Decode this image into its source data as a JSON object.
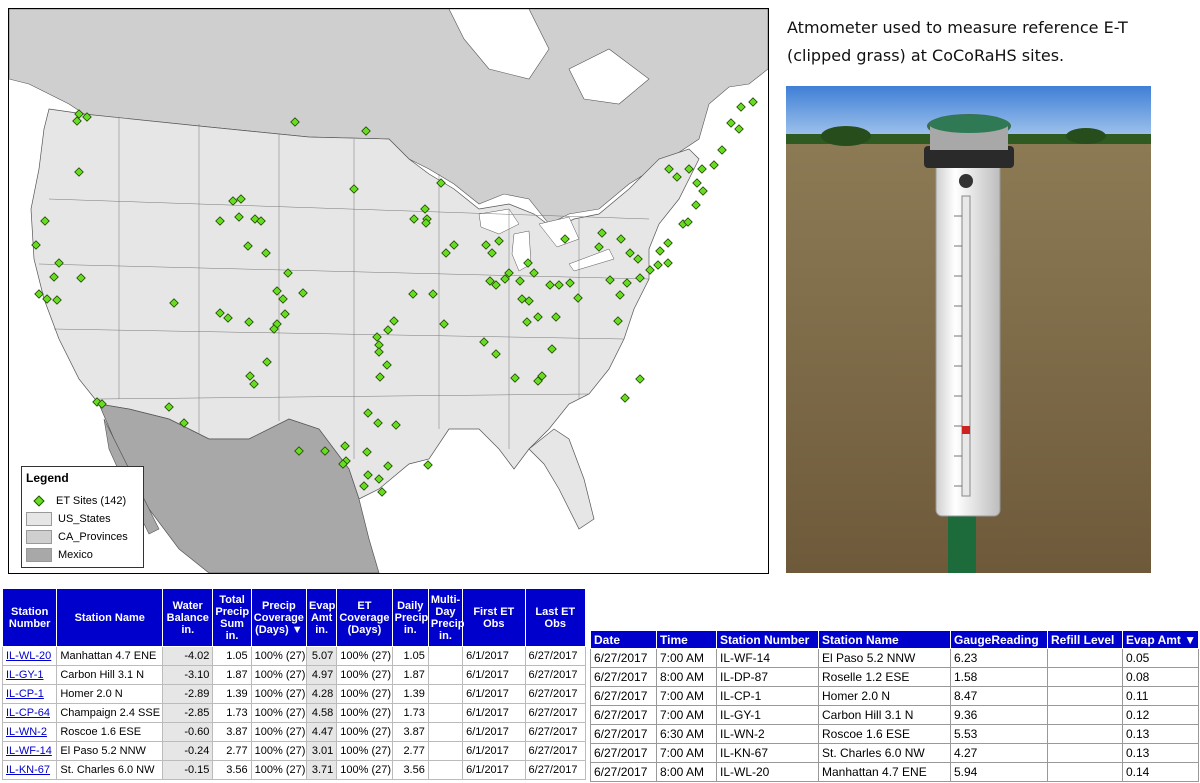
{
  "map": {
    "legend": {
      "title": "Legend",
      "items": [
        {
          "label": "ET Sites (142)",
          "kind": "marker",
          "color": "#66dd22"
        },
        {
          "label": "US_States",
          "kind": "swatch",
          "color": "#e6e6e6"
        },
        {
          "label": "CA_Provinces",
          "kind": "swatch",
          "color": "#cfcfcf"
        },
        {
          "label": "Mexico",
          "kind": "swatch",
          "color": "#a8a8a8"
        }
      ]
    },
    "colors": {
      "ocean": "#ffffff",
      "us_states": "#e6e6e6",
      "canada": "#cfcfcf",
      "mexico": "#a8a8a8",
      "marker": "#66dd22"
    }
  },
  "caption": "Atmometer used to measure reference E-T (clipped grass) at CoCoRaHS sites.",
  "left_table": {
    "headers": [
      "Station Number",
      "Station Name",
      "Water Balance in.",
      "Total Precip Sum in.",
      "Precip Coverage (Days) ▼",
      "Evap Amt in.",
      "ET Coverage (Days)",
      "Daily Precip in.",
      "Multi-Day Precip in.",
      "First ET Obs",
      "Last ET Obs"
    ],
    "rows": [
      [
        "IL-WL-20",
        "Manhattan 4.7 ENE",
        "-4.02",
        "1.05",
        "100% (27)",
        "5.07",
        "100% (27)",
        "1.05",
        "",
        "6/1/2017",
        "6/27/2017"
      ],
      [
        "IL-GY-1",
        "Carbon Hill 3.1 N",
        "-3.10",
        "1.87",
        "100% (27)",
        "4.97",
        "100% (27)",
        "1.87",
        "",
        "6/1/2017",
        "6/27/2017"
      ],
      [
        "IL-CP-1",
        "Homer 2.0 N",
        "-2.89",
        "1.39",
        "100% (27)",
        "4.28",
        "100% (27)",
        "1.39",
        "",
        "6/1/2017",
        "6/27/2017"
      ],
      [
        "IL-CP-64",
        "Champaign 2.4 SSE",
        "-2.85",
        "1.73",
        "100% (27)",
        "4.58",
        "100% (27)",
        "1.73",
        "",
        "6/1/2017",
        "6/27/2017"
      ],
      [
        "IL-WN-2",
        "Roscoe 1.6 ESE",
        "-0.60",
        "3.87",
        "100% (27)",
        "4.47",
        "100% (27)",
        "3.87",
        "",
        "6/1/2017",
        "6/27/2017"
      ],
      [
        "IL-WF-14",
        "El Paso 5.2 NNW",
        "-0.24",
        "2.77",
        "100% (27)",
        "3.01",
        "100% (27)",
        "2.77",
        "",
        "6/1/2017",
        "6/27/2017"
      ],
      [
        "IL-KN-67",
        "St. Charles 6.0 NW",
        "-0.15",
        "3.56",
        "100% (27)",
        "3.71",
        "100% (27)",
        "3.56",
        "",
        "6/1/2017",
        "6/27/2017"
      ]
    ]
  },
  "right_table": {
    "headers": [
      "Date",
      "Time",
      "Station Number",
      "Station Name",
      "GaugeReading",
      "Refill Level",
      "Evap Amt ▼"
    ],
    "rows": [
      [
        "6/27/2017",
        "7:00 AM",
        "IL-WF-14",
        "El Paso 5.2 NNW",
        "6.23",
        "",
        "0.05"
      ],
      [
        "6/27/2017",
        "8:00 AM",
        "IL-DP-87",
        "Roselle 1.2 ESE",
        "1.58",
        "",
        "0.08"
      ],
      [
        "6/27/2017",
        "7:00 AM",
        "IL-CP-1",
        "Homer 2.0 N",
        "8.47",
        "",
        "0.11"
      ],
      [
        "6/27/2017",
        "7:00 AM",
        "IL-GY-1",
        "Carbon Hill 3.1 N",
        "9.36",
        "",
        "0.12"
      ],
      [
        "6/27/2017",
        "6:30 AM",
        "IL-WN-2",
        "Roscoe 1.6 ESE",
        "5.53",
        "",
        "0.13"
      ],
      [
        "6/27/2017",
        "7:00 AM",
        "IL-KN-67",
        "St. Charles 6.0 NW",
        "4.27",
        "",
        "0.13"
      ],
      [
        "6/27/2017",
        "8:00 AM",
        "IL-WL-20",
        "Manhattan 4.7 ENE",
        "5.94",
        "",
        "0.14"
      ]
    ]
  }
}
